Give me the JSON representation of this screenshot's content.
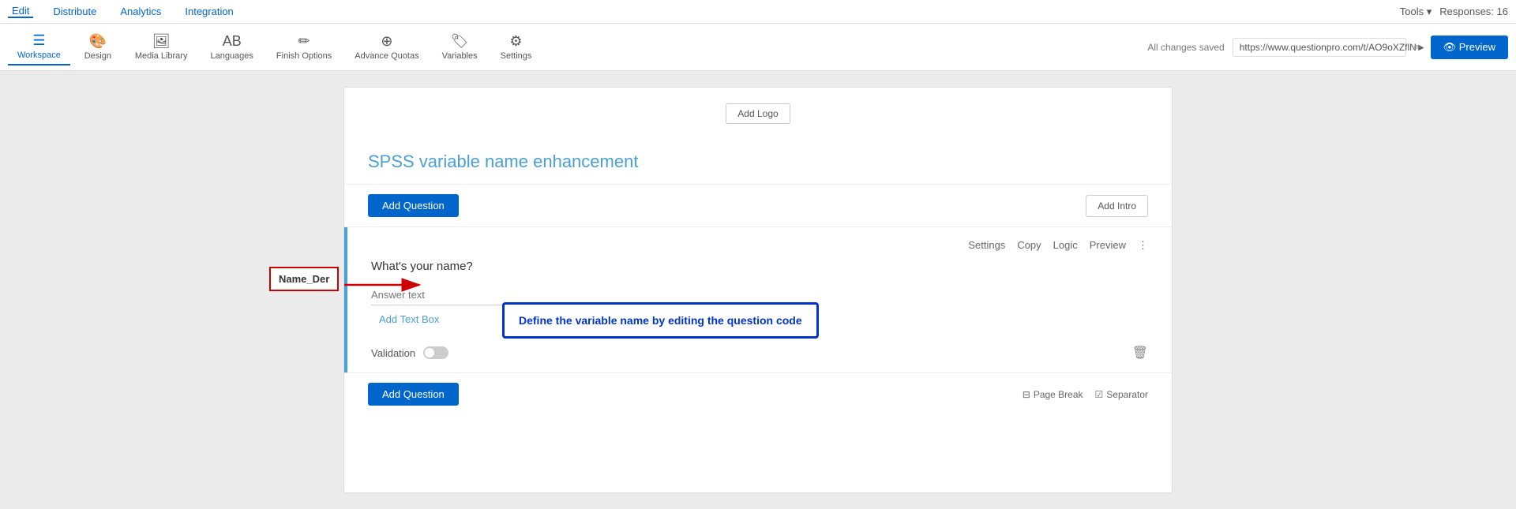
{
  "topnav": {
    "edit_label": "Edit",
    "distribute_label": "Distribute",
    "analytics_label": "Analytics",
    "integration_label": "Integration",
    "tools_label": "Tools ▾",
    "responses_label": "Responses: 16"
  },
  "toolbar": {
    "workspace_label": "Workspace",
    "design_label": "Design",
    "media_library_label": "Media Library",
    "languages_label": "Languages",
    "finish_options_label": "Finish Options",
    "advance_quotas_label": "Advance Quotas",
    "variables_label": "Variables",
    "settings_label": "Settings",
    "all_changes_saved": "All changes saved",
    "survey_url": "https://www.questionpro.com/t/AO9oXZflN►",
    "preview_label": "👁 Preview"
  },
  "survey": {
    "add_logo_label": "Add Logo",
    "title": "SPSS variable name enhancement",
    "add_question_label": "Add Question",
    "add_intro_label": "Add Intro"
  },
  "question": {
    "variable_code": "Name_Der",
    "question_text": "What's your name?",
    "answer_placeholder": "Answer text",
    "add_text_box_label": "Add Text Box",
    "settings_label": "Settings",
    "copy_label": "Copy",
    "logic_label": "Logic",
    "preview_label": "Preview",
    "more_icon": "⋮",
    "validation_label": "Validation",
    "delete_icon": "🗑"
  },
  "bottom_bar": {
    "add_question_label": "Add Question",
    "page_break_label": "Page Break",
    "separator_label": "Separator",
    "page_break_icon": "⊟",
    "separator_icon": "☑"
  },
  "tooltip": {
    "message": "Define the variable name by editing the question code"
  }
}
